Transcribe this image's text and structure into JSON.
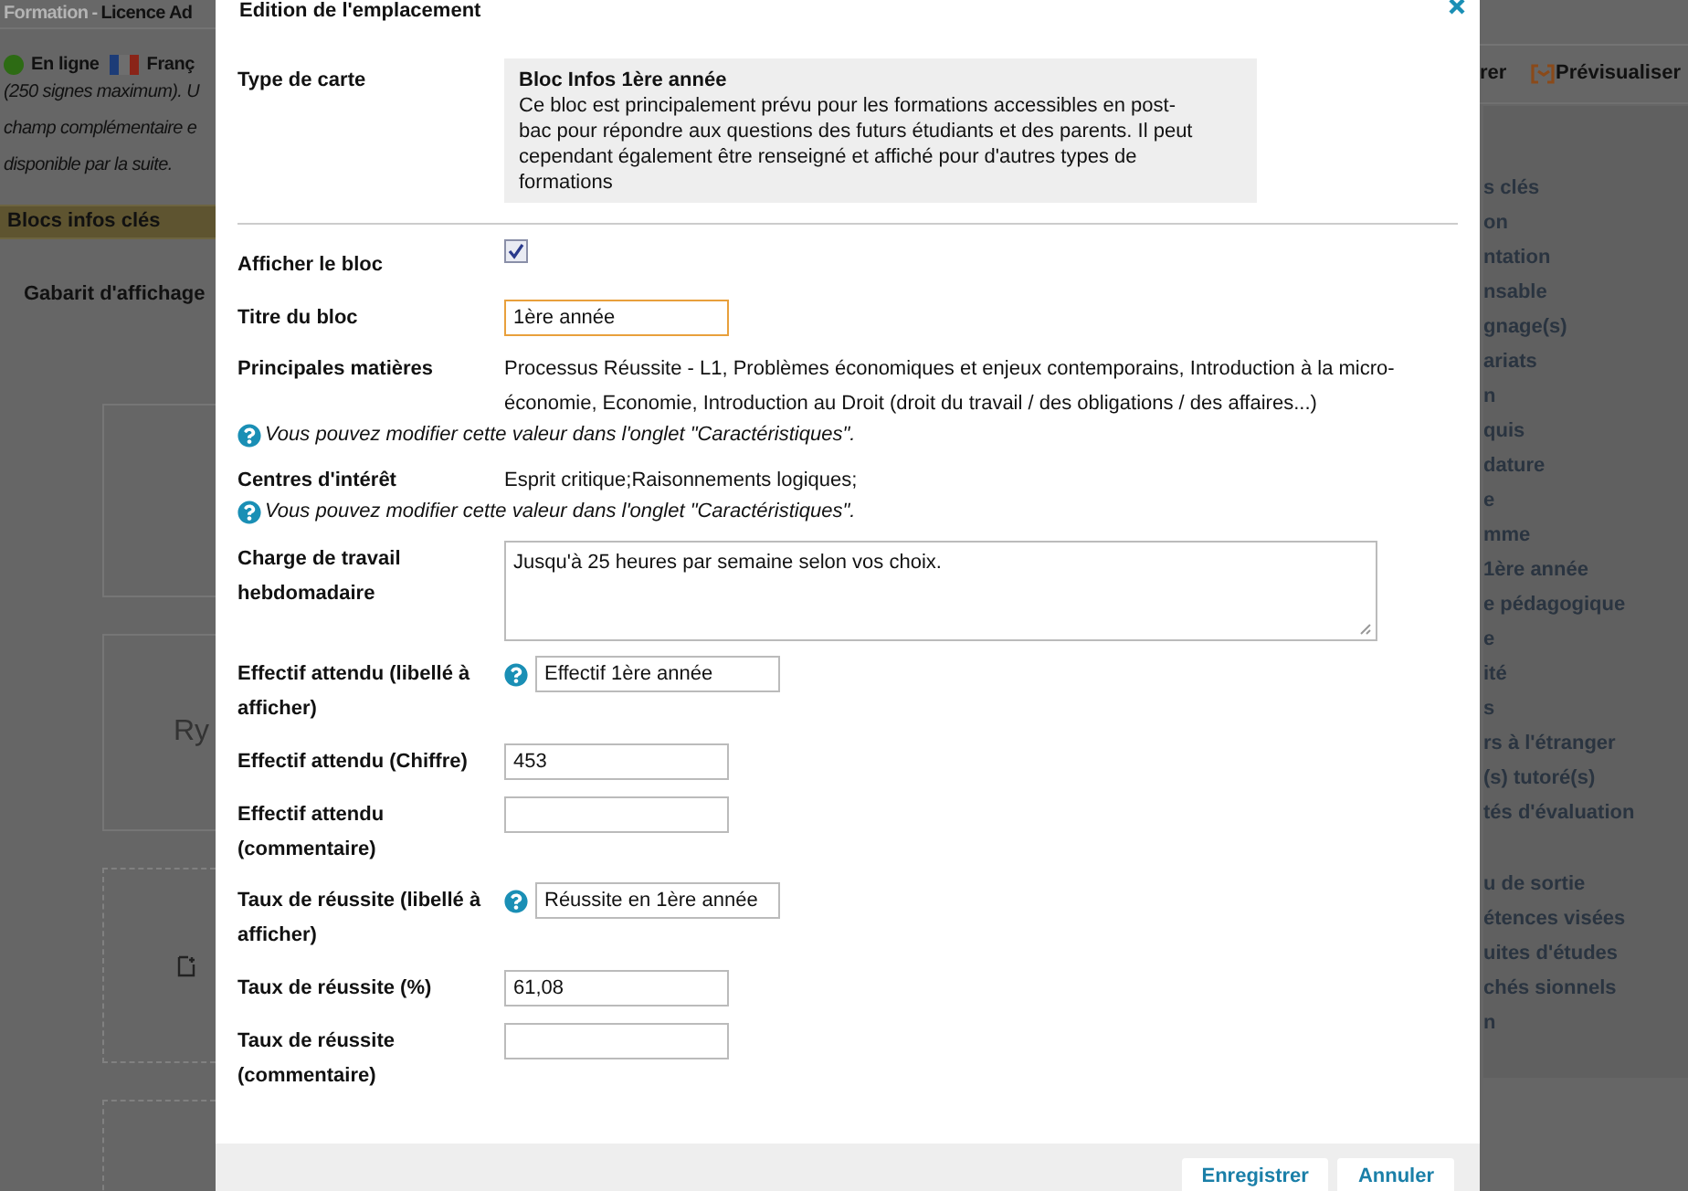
{
  "background": {
    "breadcrumb_section": "Formation",
    "breadcrumb_separator": "-",
    "breadcrumb_title": "Licence Ad",
    "status": "En ligne",
    "language": "Franç",
    "description_lines": [
      "(250 signes maximum). U",
      "champ complémentaire e",
      "disponible par la suite."
    ],
    "section_header": "Blocs infos clés",
    "template_label": "Gabarit d'affichage",
    "template_box_text": "Ry",
    "action_partial": "rer",
    "preview_button": "Prévisualiser",
    "menu_groups": [
      [
        "s clés",
        "on",
        "ntation",
        "nsable",
        "gnage(s)",
        "ariats",
        "n",
        "quis",
        "dature",
        "e",
        "mme",
        "1ère année",
        "e pédagogique",
        "e",
        "ité",
        "s",
        "rs à l'étranger",
        "(s) tutoré(s)",
        "tés d'évaluation"
      ],
      [
        "u de sortie",
        "étences visées",
        "uites d'études",
        "chés sionnels",
        "n"
      ]
    ]
  },
  "modal": {
    "title": "Edition de l'emplacement",
    "fields": [
      {
        "kind": "card_type",
        "label": "Type de carte",
        "title": "Bloc Infos 1ère année",
        "description": "Ce bloc est principalement prévu pour les formations accessibles en post-bac pour répondre aux questions des futurs étudiants et des parents. Il peut cependant également être renseigné et affiché pour d'autres types de formations"
      },
      {
        "kind": "checkbox",
        "label": "Afficher le bloc",
        "checked": true
      },
      {
        "kind": "text",
        "label": "Titre du bloc",
        "value": "1ère année",
        "focused": true
      },
      {
        "kind": "readonly",
        "label": "Principales matières",
        "value": "Processus Réussite - L1, Problèmes économiques et enjeux contemporains, Introduction à la micro-économie, Economie, Introduction au Droit (droit du travail / des obligations / des affaires...)",
        "hint": "Vous pouvez modifier cette valeur dans l'onglet \"Caractéristiques\"."
      },
      {
        "kind": "readonly",
        "label": "Centres d'intérêt",
        "value": "Esprit critique;Raisonnements logiques;",
        "hint": "Vous pouvez modifier cette valeur dans l'onglet \"Caractéristiques\"."
      },
      {
        "kind": "textarea",
        "label": "Charge de travail hebdomadaire",
        "value": "Jusqu'à 25 heures par semaine selon vos choix."
      },
      {
        "kind": "help_text",
        "label": "Effectif attendu (libellé à afficher)",
        "value": "Effectif 1ère année"
      },
      {
        "kind": "text",
        "label": "Effectif attendu (Chiffre)",
        "value": "453",
        "focused": false
      },
      {
        "kind": "text",
        "label": "Effectif attendu (commentaire)",
        "focused": false
      },
      {
        "kind": "help_text",
        "label": "Taux de réussite (libellé à afficher)",
        "value": "Réussite en 1ère année"
      },
      {
        "kind": "text",
        "label": "Taux de réussite (%)",
        "value": "61,08",
        "focused": false
      },
      {
        "kind": "text",
        "label": "Taux de réussite (commentaire)",
        "focused": false
      }
    ],
    "buttons": [
      "Enregistrer",
      "Annuler"
    ]
  }
}
